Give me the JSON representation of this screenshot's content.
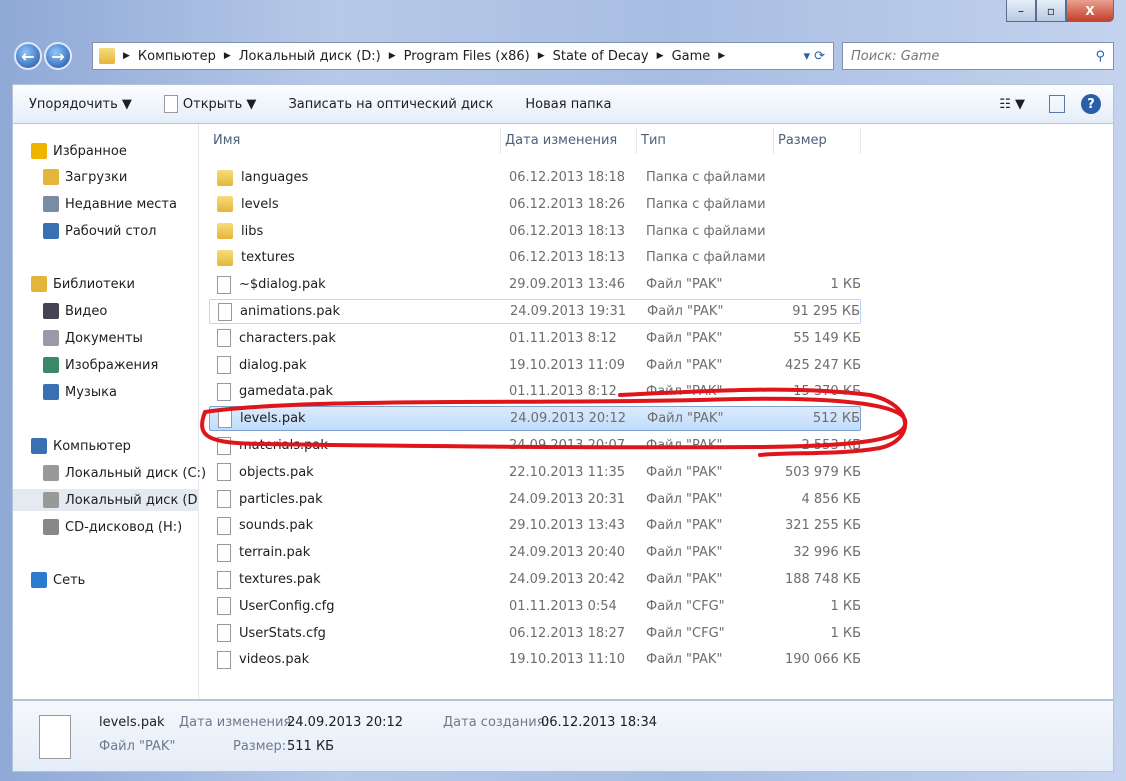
{
  "window": {
    "minimize": "–",
    "maximize": "▫",
    "close": "X"
  },
  "address": {
    "segments": [
      "Компьютер",
      "Локальный диск (D:)",
      "Program Files (x86)",
      "State of Decay",
      "Game"
    ]
  },
  "search": {
    "placeholder": "Поиск: Game"
  },
  "toolbar": {
    "organize": "Упорядочить ▼",
    "open": "Открыть ▼",
    "burn": "Записать на оптический диск",
    "new_folder": "Новая папка",
    "views": "☷ ▼",
    "help": "?"
  },
  "sidebar": {
    "items": [
      {
        "label": "Избранное",
        "icon": "star-icon",
        "level": 0
      },
      {
        "label": "Загрузки",
        "icon": "folder-icon",
        "level": 1
      },
      {
        "label": "Недавние места",
        "icon": "recent-icon",
        "level": 1
      },
      {
        "label": "Рабочий стол",
        "icon": "desktop-icon",
        "level": 1
      },
      {
        "label": "Библиотеки",
        "icon": "library-icon",
        "level": 0
      },
      {
        "label": "Видео",
        "icon": "video-icon",
        "level": 1
      },
      {
        "label": "Документы",
        "icon": "documents-icon",
        "level": 1
      },
      {
        "label": "Изображения",
        "icon": "pictures-icon",
        "level": 1
      },
      {
        "label": "Музыка",
        "icon": "music-icon",
        "level": 1
      },
      {
        "label": "Компьютер",
        "icon": "computer-icon",
        "level": 0
      },
      {
        "label": "Локальный диск (C:)",
        "icon": "drive-icon",
        "level": 1
      },
      {
        "label": "Локальный диск (D:)",
        "icon": "drive-icon",
        "level": 1,
        "selected": true
      },
      {
        "label": "CD-дисковод (H:)",
        "icon": "cd-icon",
        "level": 1
      },
      {
        "label": "Сеть",
        "icon": "network-icon",
        "level": 0
      }
    ]
  },
  "columns": [
    "Имя",
    "Дата изменения",
    "Тип",
    "Размер"
  ],
  "files": [
    {
      "name": "languages",
      "date": "06.12.2013 18:18",
      "type": "Папка с файлами",
      "size": "",
      "folder": true
    },
    {
      "name": "levels",
      "date": "06.12.2013 18:26",
      "type": "Папка с файлами",
      "size": "",
      "folder": true
    },
    {
      "name": "libs",
      "date": "06.12.2013 18:13",
      "type": "Папка с файлами",
      "size": "",
      "folder": true
    },
    {
      "name": "textures",
      "date": "06.12.2013 18:13",
      "type": "Папка с файлами",
      "size": "",
      "folder": true
    },
    {
      "name": "~$dialog.pak",
      "date": "29.09.2013 13:46",
      "type": "Файл \"PAK\"",
      "size": "1 КБ"
    },
    {
      "name": "animations.pak",
      "date": "24.09.2013 19:31",
      "type": "Файл \"PAK\"",
      "size": "91 295 КБ",
      "hover": true
    },
    {
      "name": "characters.pak",
      "date": "01.11.2013 8:12",
      "type": "Файл \"PAK\"",
      "size": "55 149 КБ"
    },
    {
      "name": "dialog.pak",
      "date": "19.10.2013 11:09",
      "type": "Файл \"PAK\"",
      "size": "425 247 КБ"
    },
    {
      "name": "gamedata.pak",
      "date": "01.11.2013 8:12",
      "type": "Файл \"PAK\"",
      "size": "15 370 КБ"
    },
    {
      "name": "levels.pak",
      "date": "24.09.2013 20:12",
      "type": "Файл \"PAK\"",
      "size": "512 КБ",
      "selected": true
    },
    {
      "name": "materials.pak",
      "date": "24.09.2013 20:07",
      "type": "Файл \"PAK\"",
      "size": "2 553 КБ"
    },
    {
      "name": "objects.pak",
      "date": "22.10.2013 11:35",
      "type": "Файл \"PAK\"",
      "size": "503 979 КБ"
    },
    {
      "name": "particles.pak",
      "date": "24.09.2013 20:31",
      "type": "Файл \"PAK\"",
      "size": "4 856 КБ"
    },
    {
      "name": "sounds.pak",
      "date": "29.10.2013 13:43",
      "type": "Файл \"PAK\"",
      "size": "321 255 КБ"
    },
    {
      "name": "terrain.pak",
      "date": "24.09.2013 20:40",
      "type": "Файл \"PAK\"",
      "size": "32 996 КБ"
    },
    {
      "name": "textures.pak",
      "date": "24.09.2013 20:42",
      "type": "Файл \"PAK\"",
      "size": "188 748 КБ"
    },
    {
      "name": "UserConfig.cfg",
      "date": "01.11.2013 0:54",
      "type": "Файл \"CFG\"",
      "size": "1 КБ"
    },
    {
      "name": "UserStats.cfg",
      "date": "06.12.2013 18:27",
      "type": "Файл \"CFG\"",
      "size": "1 КБ"
    },
    {
      "name": "videos.pak",
      "date": "19.10.2013 11:10",
      "type": "Файл \"PAK\"",
      "size": "190 066 КБ"
    }
  ],
  "details": {
    "name": "levels.pak",
    "type": "Файл \"PAK\"",
    "modified_label": "Дата изменения:",
    "modified": "24.09.2013 20:12",
    "created_label": "Дата создания:",
    "created": "06.12.2013 18:34",
    "size_label": "Размер:",
    "size": "511 КБ"
  },
  "annotation": {
    "color": "#e0151b"
  }
}
